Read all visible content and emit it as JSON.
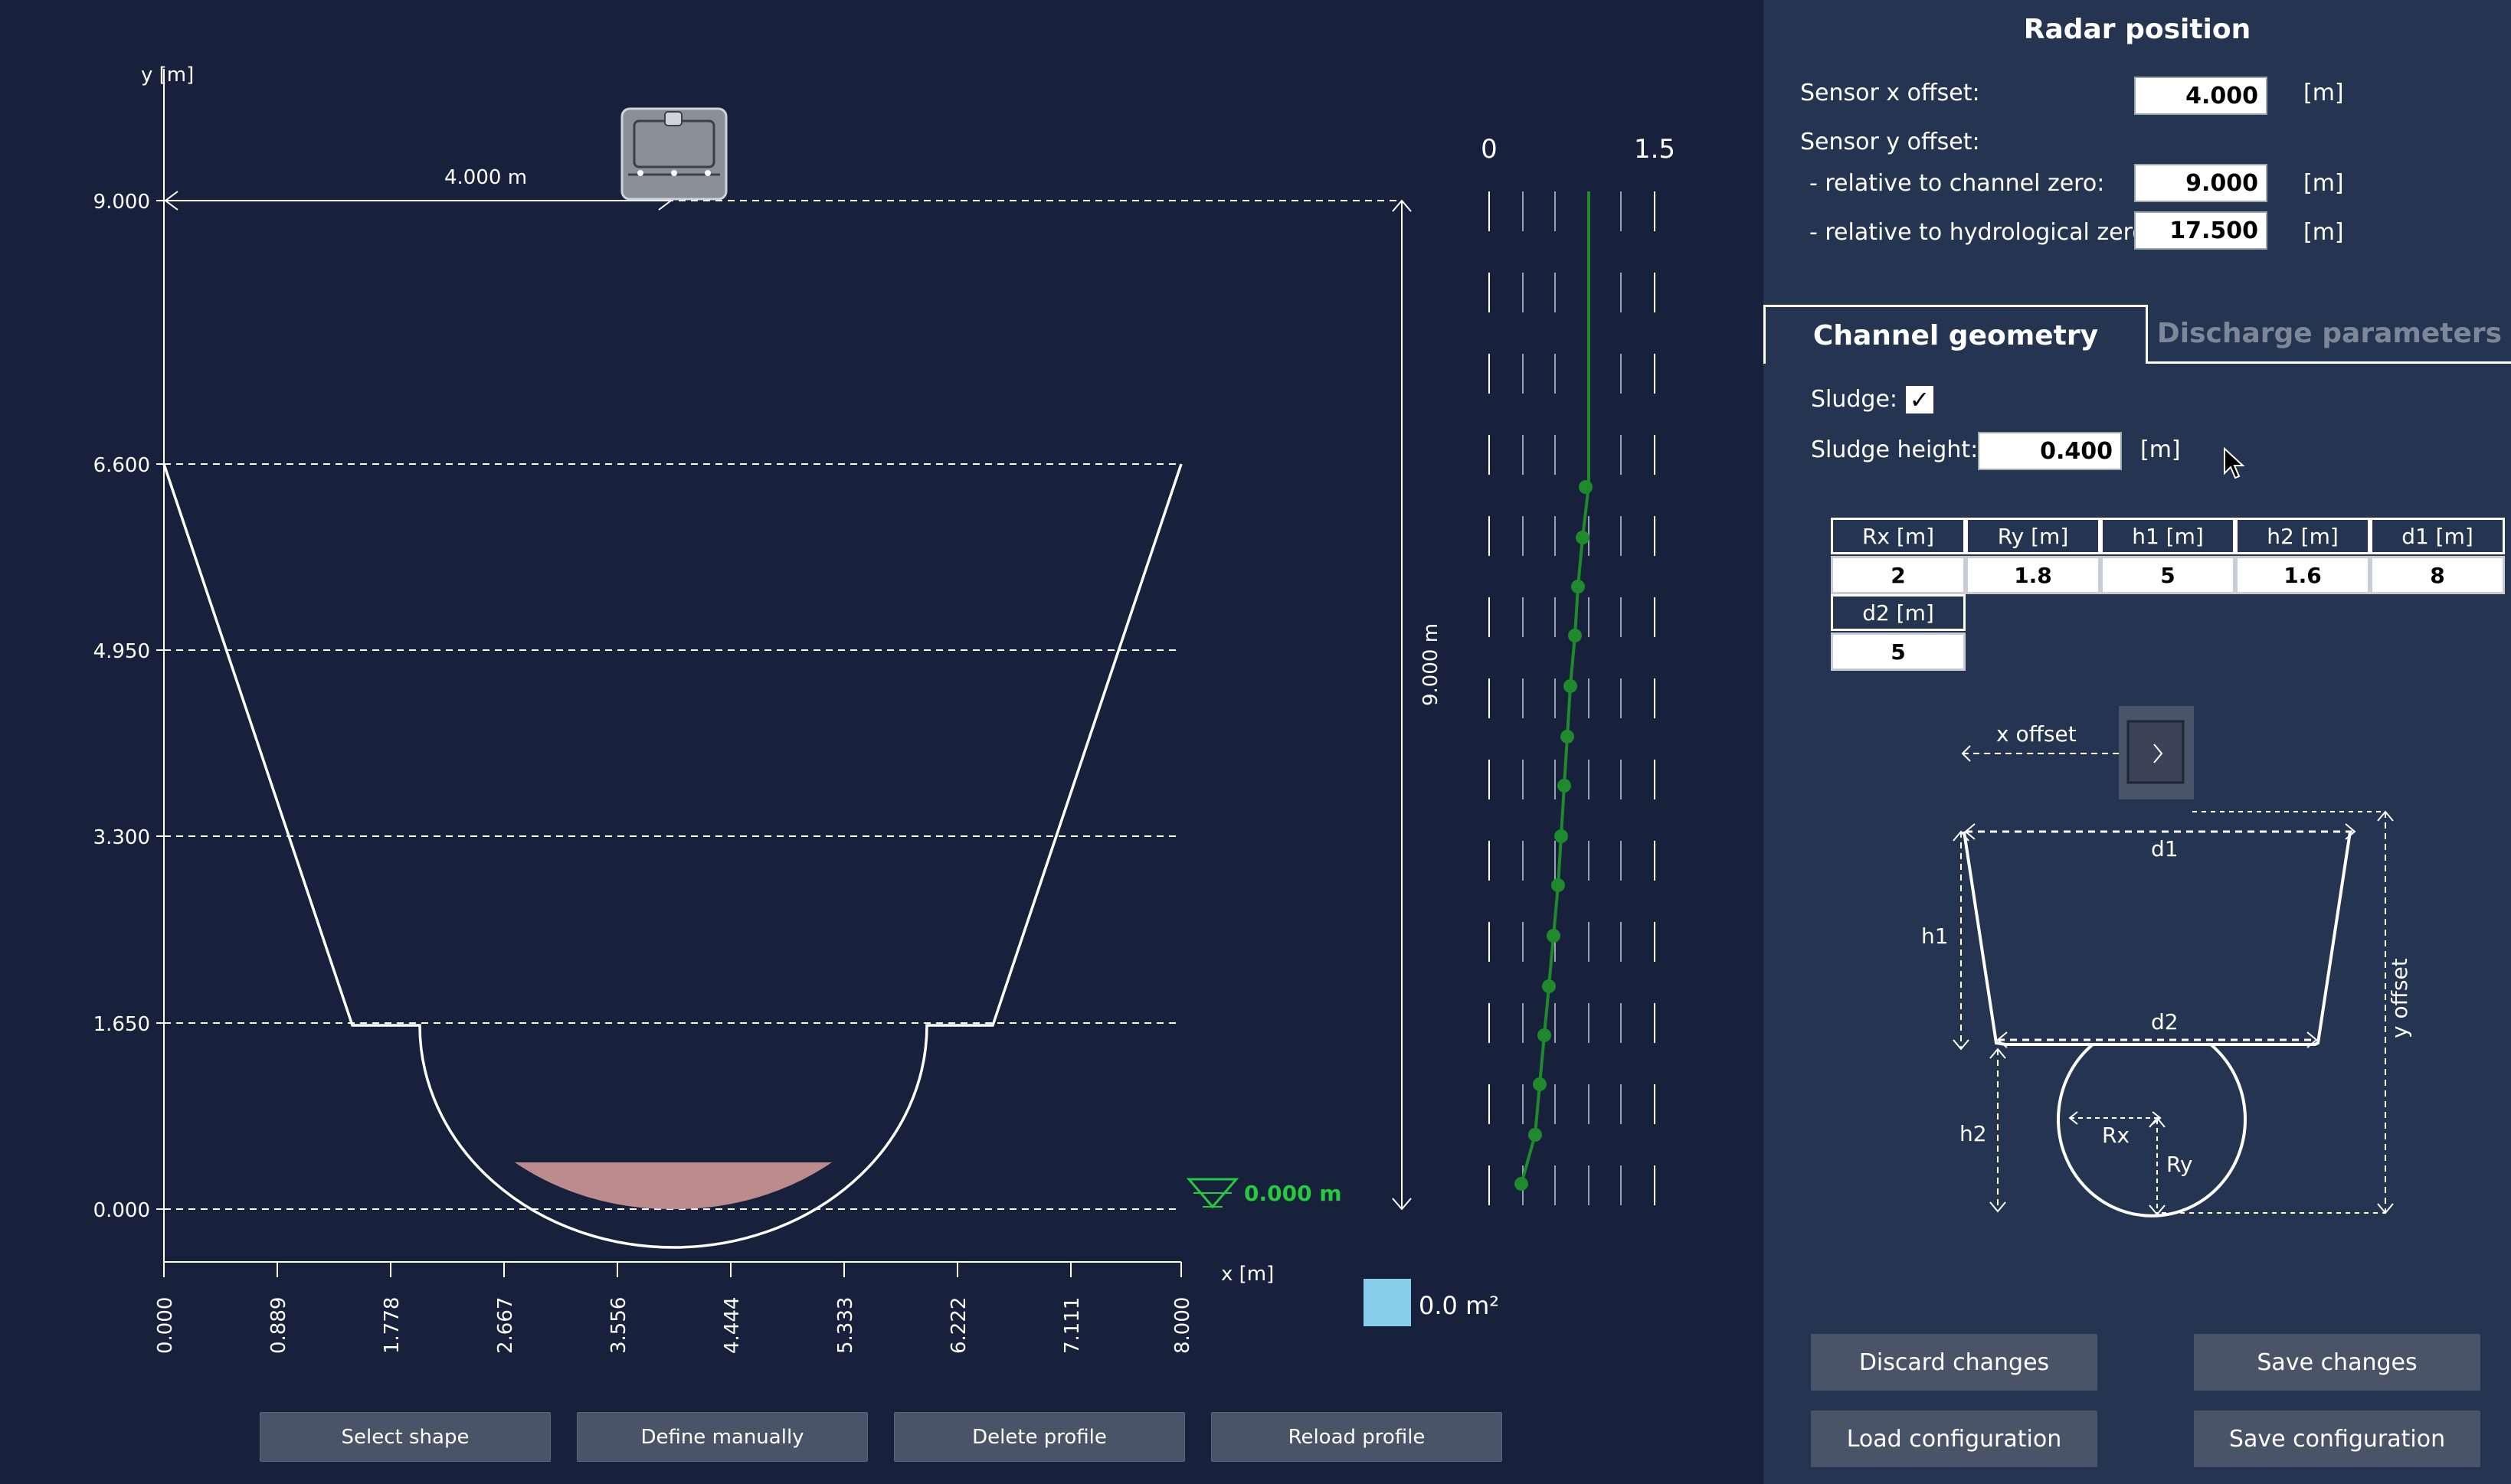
{
  "plot": {
    "y_label": "y [m]",
    "x_label": "x [m]",
    "y_ticks": [
      "9.000",
      "6.600",
      "4.950",
      "3.300",
      "1.650",
      "0.000"
    ],
    "x_ticks": [
      "0.000",
      "0.889",
      "1.778",
      "2.667",
      "3.556",
      "4.444",
      "5.333",
      "6.222",
      "7.111",
      "8.000"
    ],
    "sensor_x_dim": "4.000  m",
    "sensor_y_dim": "9.000 m",
    "water_level": "0.000 m",
    "strip_min": "0",
    "strip_max": "1.5",
    "area_value": "0.0 m²",
    "colors": {
      "water_level": "#27c93f",
      "sludge": "#c49191",
      "velocity": "#1f8a2c",
      "area_swatch": "#87ceeb"
    }
  },
  "bottom_buttons": {
    "select_shape": "Select shape",
    "define_manually": "Define manually",
    "delete_profile": "Delete profile",
    "reload_profile": "Reload profile"
  },
  "panel": {
    "title": "Radar position",
    "sensor_x_label": "Sensor x offset:",
    "sensor_x_value": "4.000",
    "sensor_y_label": "Sensor y offset:",
    "rel_channel_label": "- relative to channel zero:",
    "rel_channel_value": "9.000",
    "rel_hydro_label": "- relative to hydrological zero:",
    "rel_hydro_value": "17.500",
    "unit": "[m]",
    "tab_geometry": "Channel geometry",
    "tab_discharge": "Discharge parameters",
    "sludge_label": "Sludge:",
    "sludge_checked": "✓",
    "sludge_height_label": "Sludge height:",
    "sludge_height_value": "0.400",
    "table_headers": [
      "Rx [m]",
      "Ry [m]",
      "h1 [m]",
      "h2 [m]",
      "d1 [m]",
      "d2 [m]"
    ],
    "table_values": [
      "2",
      "1.8",
      "5",
      "1.6",
      "8",
      "5"
    ],
    "diagram": {
      "x_offset": "x offset",
      "y_offset": "y offset",
      "d1": "d1",
      "d2": "d2",
      "h1": "h1",
      "h2": "h2",
      "rx": "Rx",
      "ry": "Ry"
    },
    "discard": "Discard changes",
    "save_changes": "Save changes",
    "load_config": "Load configuration",
    "save_config": "Save configuration"
  }
}
